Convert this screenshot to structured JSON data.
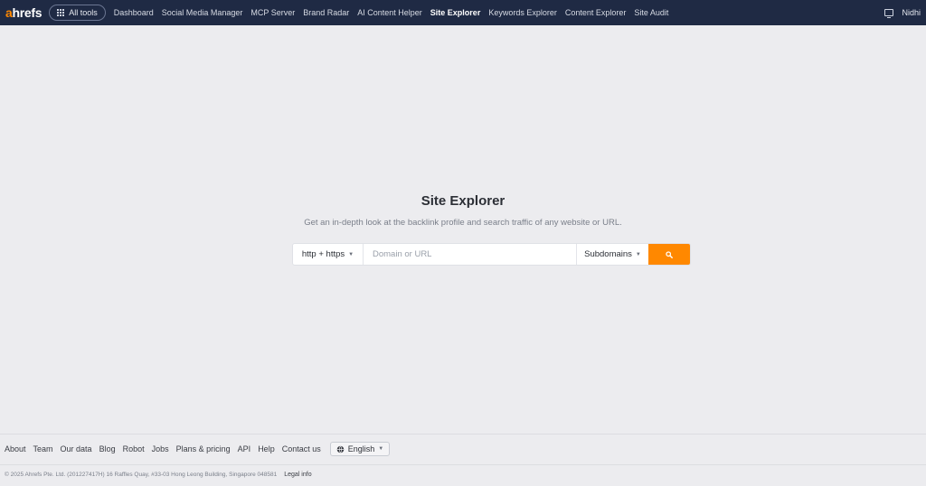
{
  "header": {
    "logo_prefix": "a",
    "logo_rest": "hrefs",
    "all_tools_label": "All tools",
    "nav": [
      {
        "label": "Dashboard",
        "active": false
      },
      {
        "label": "Social Media Manager",
        "active": false
      },
      {
        "label": "MCP Server",
        "active": false
      },
      {
        "label": "Brand Radar",
        "active": false
      },
      {
        "label": "AI Content Helper",
        "active": false
      },
      {
        "label": "Site Explorer",
        "active": true
      },
      {
        "label": "Keywords Explorer",
        "active": false
      },
      {
        "label": "Content Explorer",
        "active": false
      },
      {
        "label": "Site Audit",
        "active": false
      }
    ],
    "username": "Nidhi",
    "icons": {
      "all_tools": "grid-icon",
      "device": "monitor-icon"
    }
  },
  "main": {
    "title": "Site Explorer",
    "subtitle": "Get an in-depth look at the backlink profile and search traffic of any website or URL.",
    "search": {
      "protocol": "http + https",
      "placeholder": "Domain or URL",
      "value": "",
      "mode": "Subdomains",
      "button_icon": "search-icon"
    }
  },
  "footer": {
    "links": [
      "About",
      "Team",
      "Our data",
      "Blog",
      "Robot",
      "Jobs",
      "Plans & pricing",
      "API",
      "Help",
      "Contact us"
    ],
    "language": "English",
    "copyright": "© 2025 Ahrefs Pte. Ltd. (201227417H) 16 Raffles Quay, #33-03 Hong Leong Building, Singapore 048581",
    "legal_link": "Legal info"
  },
  "colors": {
    "nav_bg": "#1f2a44",
    "accent": "#ff8800",
    "page_bg": "#ececef"
  }
}
